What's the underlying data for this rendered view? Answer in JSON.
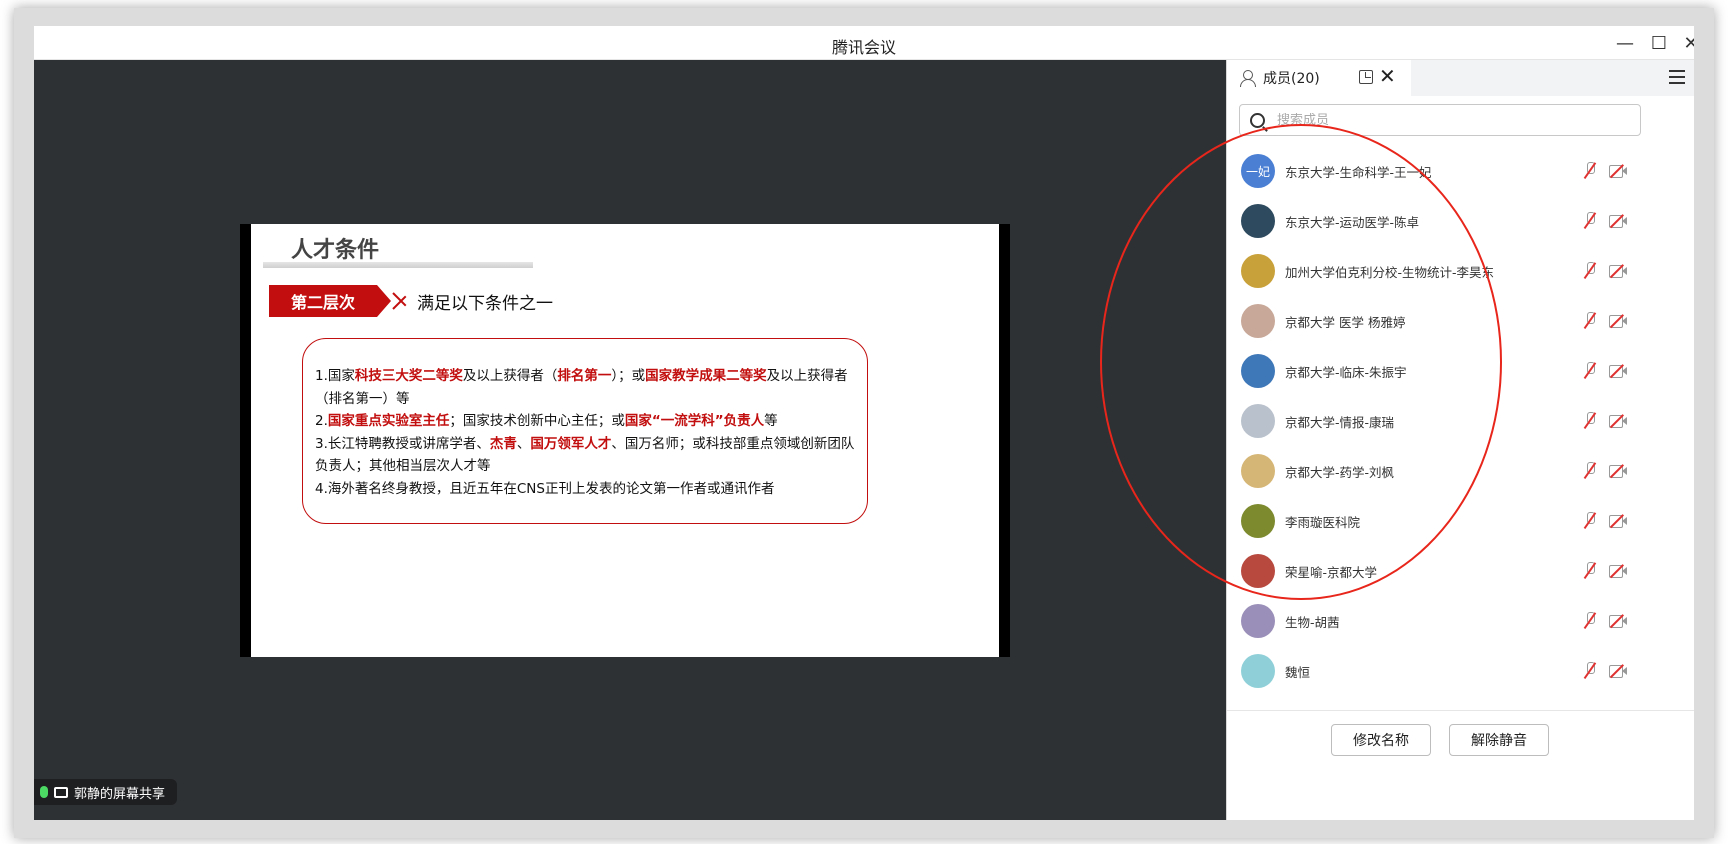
{
  "window": {
    "title": "腾讯会议"
  },
  "slide": {
    "title": "人才条件",
    "level_badge": "第二层次",
    "level_text": "满足以下条件之一",
    "conditions": {
      "c1": [
        {
          "t": "1.国家",
          "r": false
        },
        {
          "t": "科技三大奖二等奖",
          "r": true
        },
        {
          "t": "及以上获得者（",
          "r": false
        },
        {
          "t": "排名第一",
          "r": true
        },
        {
          "t": "）；或",
          "r": false
        },
        {
          "t": "国家教学成果二等奖",
          "r": true
        },
        {
          "t": "及以上获得者（排名第一）等",
          "r": false
        }
      ],
      "c2": [
        {
          "t": "2.",
          "r": false
        },
        {
          "t": "国家重点实验室主任",
          "r": true
        },
        {
          "t": "；国家技术创新中心主任；或",
          "r": false
        },
        {
          "t": "国家“一流学科”负责人",
          "r": true
        },
        {
          "t": "等",
          "r": false
        }
      ],
      "c3": [
        {
          "t": "3.长江特聘教授或讲席学者、",
          "r": false
        },
        {
          "t": "杰青",
          "r": true
        },
        {
          "t": "、",
          "r": false
        },
        {
          "t": "国万领军人才",
          "r": true
        },
        {
          "t": "、国万名师；或科技部重点领域创新团队负责人；其他相当层次人才等",
          "r": false
        }
      ],
      "c4": [
        {
          "t": "4.海外著名终身教授，且近五年在CNS正刊上发表的论文第一作者或通讯作者",
          "r": false
        }
      ]
    }
  },
  "share_tag": {
    "label": "郭静的屏幕共享"
  },
  "panel": {
    "tab_label": "成员(20)",
    "search_placeholder": "搜索成员",
    "members": [
      {
        "name": "东京大学-生命科学-王一妃",
        "avatar_text": "一妃",
        "color": "#4a7fd4"
      },
      {
        "name": "东京大学-运动医学-陈卓",
        "avatar_text": "",
        "color": "#2d4a5e"
      },
      {
        "name": "加州大学伯克利分校-生物统计-李昊东",
        "avatar_text": "",
        "color": "#c9a13a"
      },
      {
        "name": "京都大学 医学 杨雅婷",
        "avatar_text": "",
        "color": "#c8a898"
      },
      {
        "name": "京都大学-临床-朱振宇",
        "avatar_text": "",
        "color": "#3f78b8"
      },
      {
        "name": "京都大学-情报-康瑞",
        "avatar_text": "",
        "color": "#b9c1cc"
      },
      {
        "name": "京都大学-药学-刘枫",
        "avatar_text": "",
        "color": "#d6b676"
      },
      {
        "name": "李雨璇医科院",
        "avatar_text": "",
        "color": "#7d8a2e"
      },
      {
        "name": "荣星喻-京都大学",
        "avatar_text": "",
        "color": "#b8493f"
      },
      {
        "name": "生物-胡茜",
        "avatar_text": "",
        "color": "#9a8fb8"
      },
      {
        "name": "魏恒",
        "avatar_text": "",
        "color": "#8fd0d8"
      }
    ],
    "buttons": {
      "rename": "修改名称",
      "unmute": "解除静音"
    }
  }
}
